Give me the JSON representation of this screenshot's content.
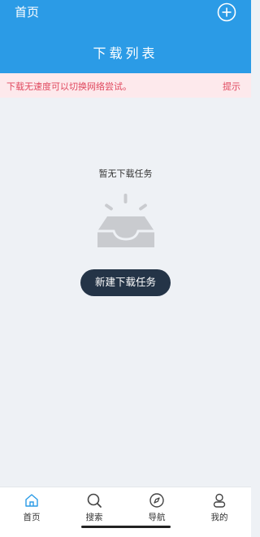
{
  "header": {
    "home_link": "首页",
    "title": "下载列表",
    "add_icon": "plus-circle-icon"
  },
  "notice": {
    "message": "下载无速度可以切换网络尝试。",
    "hint": "提示"
  },
  "empty_state": {
    "text": "暂无下载任务",
    "icon": "empty-inbox-icon",
    "button_label": "新建下载任务"
  },
  "tabbar": {
    "tabs": [
      {
        "label": "首页",
        "icon": "home-icon",
        "active": true
      },
      {
        "label": "搜索",
        "icon": "search-icon",
        "active": false
      },
      {
        "label": "导航",
        "icon": "compass-icon",
        "active": false
      },
      {
        "label": "我的",
        "icon": "user-icon",
        "active": false
      }
    ]
  },
  "colors": {
    "header_bg": "#2b9be6",
    "notice_bg": "#fde9ec",
    "notice_text": "#e0475d",
    "button_bg": "#243447",
    "active_tab": "#2b9be6"
  }
}
